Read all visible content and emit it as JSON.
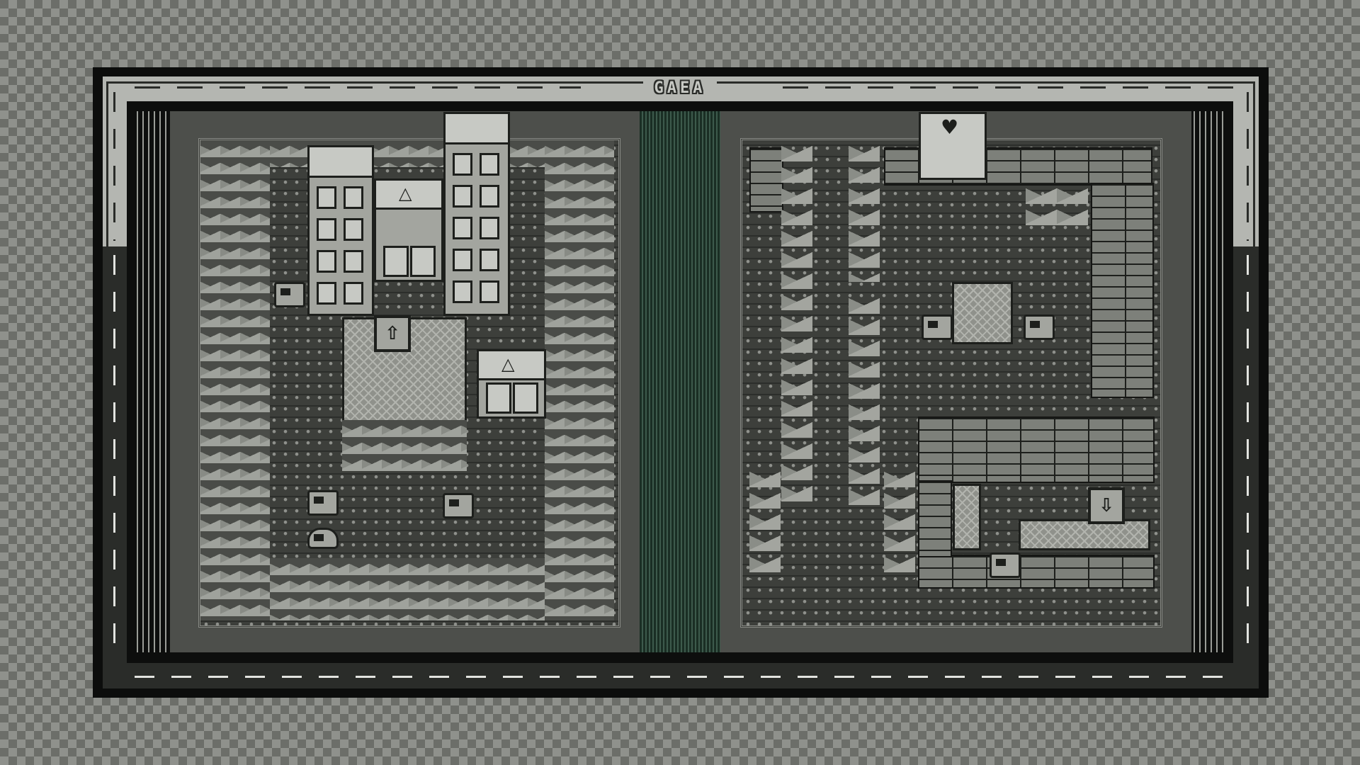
{
  "title": "GAEA",
  "palette": {
    "darkest": "#1d1f1c",
    "dark": "#4d4f4b",
    "light": "#a3a59f",
    "lightest": "#c7c9c4",
    "water": "#3d5a4c"
  },
  "left_map": {
    "stairs_icon": "stairs-up-icon",
    "stairs_glyph": "⇧",
    "shop_sign_glyph": "△",
    "sprites": [
      "signpost-sprite",
      "creature-sprite",
      "cart-sprite",
      "slime-sprite"
    ]
  },
  "right_map": {
    "stairs_icon": "stairs-down-icon",
    "stairs_glyph": "⇩",
    "gate_glyph": "♥",
    "sprites": [
      "signpost-sprite",
      "signpost-sprite",
      "signpost-sprite"
    ]
  }
}
